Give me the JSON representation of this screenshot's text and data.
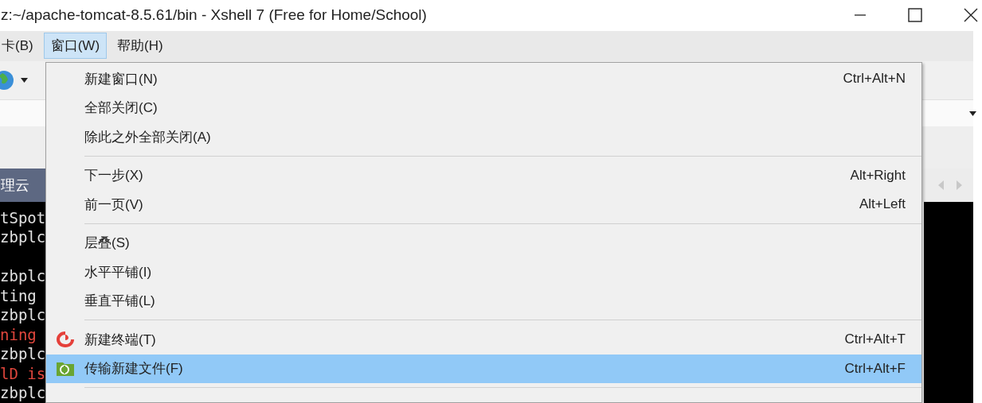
{
  "window": {
    "title": "z:~/apache-tomcat-8.5.61/bin - Xshell 7 (Free for Home/School)"
  },
  "menu_bar": [
    {
      "label": "卡(B)",
      "selected": false
    },
    {
      "label": "窗口(W)",
      "selected": true
    },
    {
      "label": "帮助(H)",
      "selected": false
    }
  ],
  "session_tab": {
    "label": "理云"
  },
  "terminal_left": [
    {
      "kind": "normal",
      "text": "tSpot"
    },
    {
      "kind": "normal",
      "text": "zbplc"
    },
    {
      "kind": "blank"
    },
    {
      "kind": "normal",
      "text": "zbplc"
    },
    {
      "kind": "normal",
      "text": "ting"
    },
    {
      "kind": "normal",
      "text": "zbplc"
    },
    {
      "kind": "error",
      "text": "ning"
    },
    {
      "kind": "normal",
      "text": "zbplc"
    },
    {
      "kind": "error",
      "text": "lD is"
    },
    {
      "kind": "normal",
      "text": "zbplc"
    }
  ],
  "window_menu": [
    {
      "kind": "item",
      "label": "新建窗口(N)",
      "shortcut": "Ctrl+Alt+N",
      "selected": false
    },
    {
      "kind": "item",
      "label": "全部关闭(C)",
      "selected": false
    },
    {
      "kind": "item",
      "label": "除此之外全部关闭(A)",
      "selected": false
    },
    {
      "kind": "separator"
    },
    {
      "kind": "item",
      "label": "下一步(X)",
      "shortcut": "Alt+Right",
      "selected": false
    },
    {
      "kind": "item",
      "label": "前一页(V)",
      "shortcut": "Alt+Left",
      "selected": false
    },
    {
      "kind": "separator"
    },
    {
      "kind": "item",
      "label": "层叠(S)",
      "selected": false
    },
    {
      "kind": "item",
      "label": "水平平铺(I)",
      "selected": false
    },
    {
      "kind": "item",
      "label": "垂直平铺(L)",
      "selected": false
    },
    {
      "kind": "separator"
    },
    {
      "kind": "item",
      "label": "新建终端(T)",
      "shortcut": "Ctrl+Alt+T",
      "selected": false
    },
    {
      "kind": "item",
      "label": "传输新建文件(F)",
      "shortcut": "Ctrl+Alt+F",
      "selected": true
    },
    {
      "kind": "separator"
    }
  ]
}
